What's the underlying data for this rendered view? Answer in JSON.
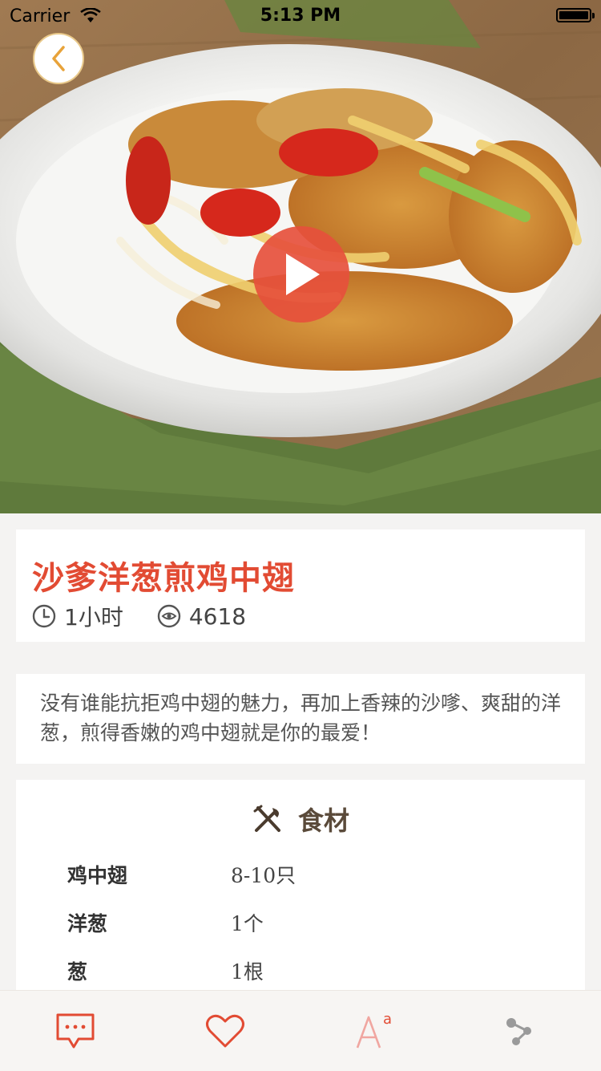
{
  "status_bar": {
    "carrier": "Carrier",
    "time": "5:13 PM"
  },
  "recipe": {
    "title": "沙爹洋葱煎鸡中翅",
    "duration": "1小时",
    "views": "4618",
    "description": "没有谁能抗拒鸡中翅的魅力，再加上香辣的沙嗲、爽甜的洋葱，煎得香嫩的鸡中翅就是你的最爱！"
  },
  "ingredients": {
    "heading": "食材",
    "items": [
      {
        "name": "鸡中翅",
        "amount": "8-10只"
      },
      {
        "name": "洋葱",
        "amount": "1个"
      },
      {
        "name": "葱",
        "amount": "1根"
      }
    ]
  },
  "tabbar": {
    "icons": [
      "comment-icon",
      "heart-icon",
      "font-size-icon",
      "share-icon"
    ]
  },
  "colors": {
    "accent": "#e24b33",
    "play": "#e6503c",
    "back_border": "#e9c98a"
  }
}
